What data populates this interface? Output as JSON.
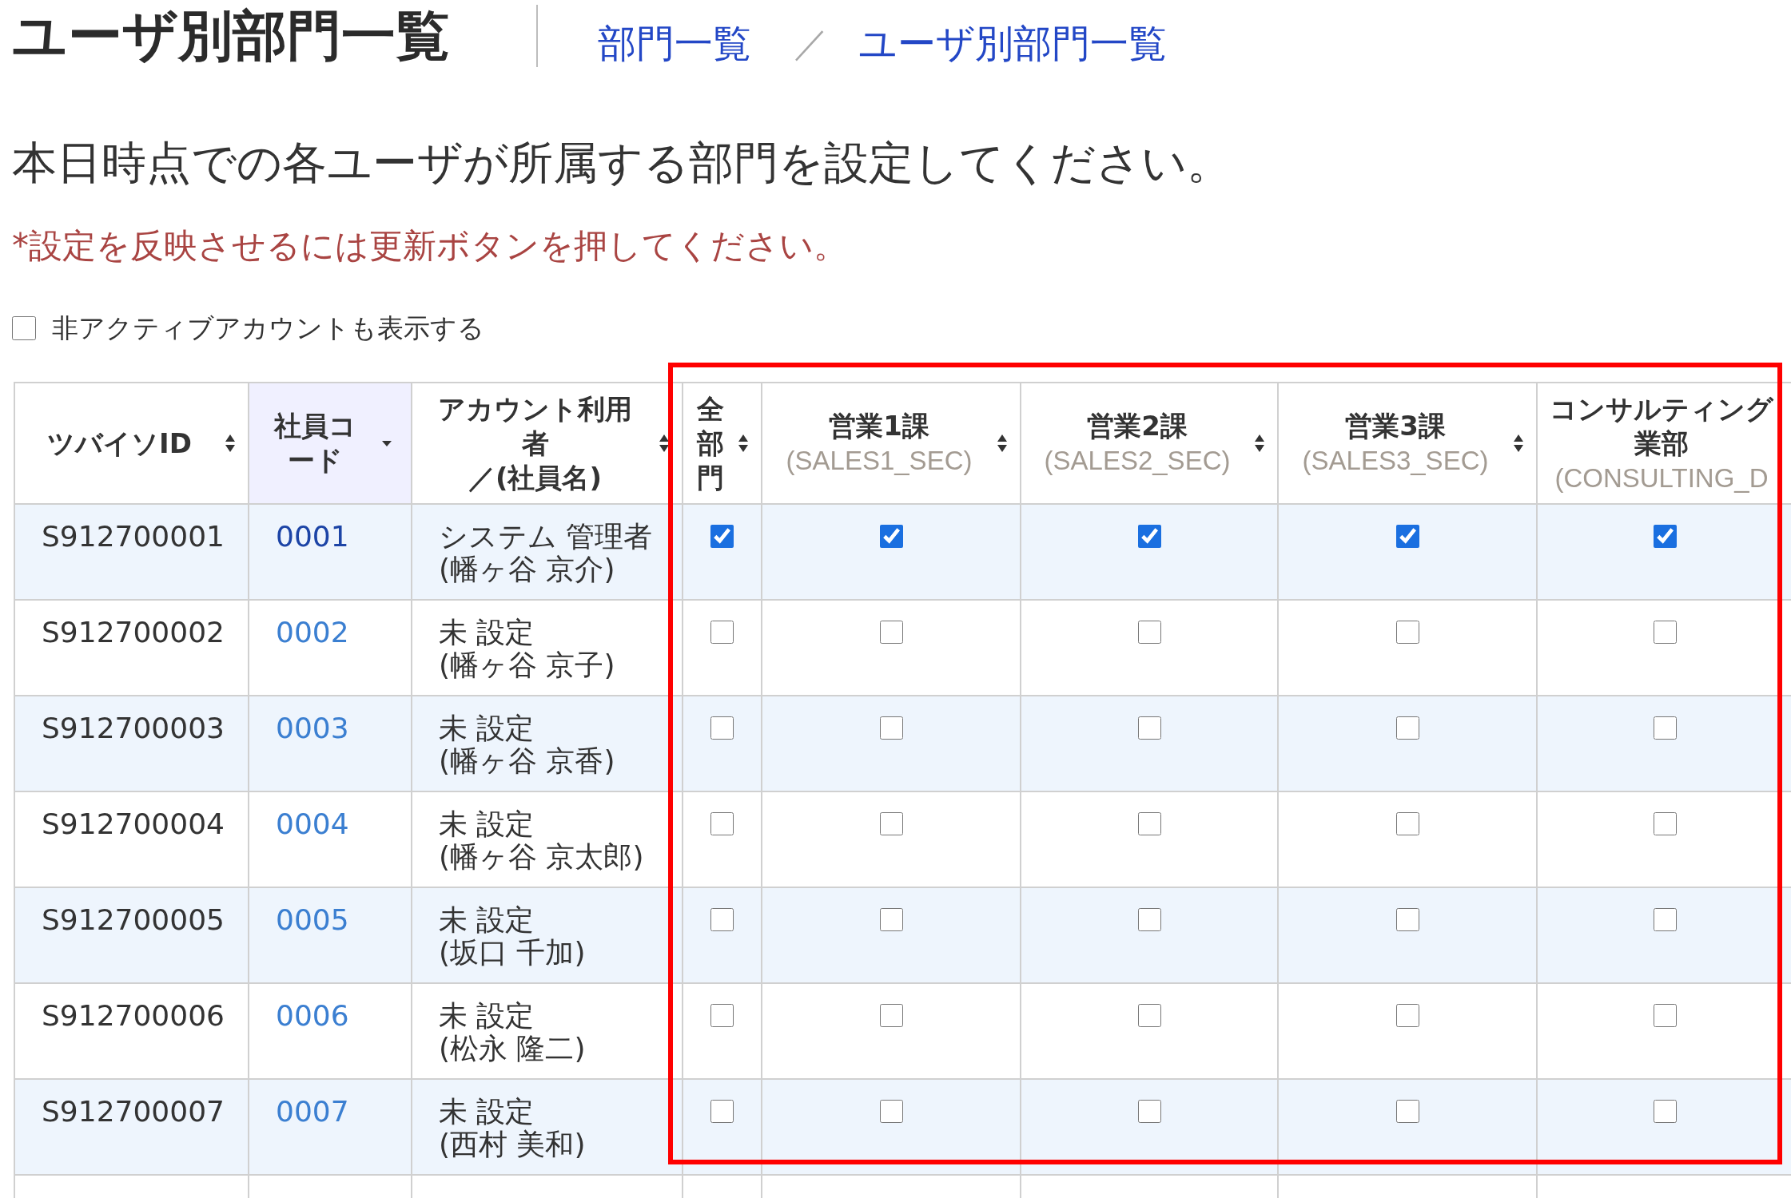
{
  "header": {
    "title": "ユーザ別部門一覧",
    "breadcrumb": [
      {
        "label": "部門一覧"
      },
      {
        "label": "ユーザ別部門一覧"
      }
    ],
    "breadcrumb_separator": "／"
  },
  "instruction": "本日時点での各ユーザが所属する部門を設定してください。",
  "note": "*設定を反映させるには更新ボタンを押してください。",
  "show_inactive": {
    "label": "非アクティブアカウントも表示する",
    "checked": false
  },
  "table": {
    "columns": [
      {
        "lines": [
          "ツバイソID"
        ],
        "sortable": true,
        "sorted": false
      },
      {
        "lines": [
          "社員コード"
        ],
        "sortable": true,
        "sorted": true
      },
      {
        "lines": [
          "アカウント利用者",
          "／(社員名)"
        ],
        "sortable": true,
        "sorted": false
      },
      {
        "lines": [
          "全部門"
        ],
        "sortable": true,
        "sorted": false
      },
      {
        "lines": [
          "営業1課"
        ],
        "code": "(SALES1_SEC)",
        "sortable": true,
        "sorted": false
      },
      {
        "lines": [
          "営業2課"
        ],
        "code": "(SALES2_SEC)",
        "sortable": true,
        "sorted": false
      },
      {
        "lines": [
          "営業3課"
        ],
        "code": "(SALES3_SEC)",
        "sortable": true,
        "sorted": false
      },
      {
        "lines": [
          "コンサルティング",
          "業部"
        ],
        "code": "(CONSULTING_D"
      }
    ],
    "rows": [
      {
        "user_id": "S912700001",
        "employee_code": "0001",
        "visited": true,
        "account_user": "システム 管理者",
        "employee_name": "(幡ヶ谷 京介)",
        "checks": [
          {
            "checked": true
          },
          {
            "checked": true
          },
          {
            "checked": true
          },
          {
            "checked": true
          },
          {
            "checked": true
          }
        ]
      },
      {
        "user_id": "S912700002",
        "employee_code": "0002",
        "visited": false,
        "account_user": "未 設定",
        "employee_name": "(幡ヶ谷 京子)",
        "checks": [
          {
            "checked": false
          },
          {
            "checked": false
          },
          {
            "checked": false
          },
          {
            "checked": false
          },
          {
            "checked": false
          }
        ]
      },
      {
        "user_id": "S912700003",
        "employee_code": "0003",
        "visited": false,
        "account_user": "未 設定",
        "employee_name": "(幡ヶ谷 京香)",
        "checks": [
          {
            "checked": false
          },
          {
            "checked": false
          },
          {
            "checked": false
          },
          {
            "checked": false
          },
          {
            "checked": false
          }
        ]
      },
      {
        "user_id": "S912700004",
        "employee_code": "0004",
        "visited": false,
        "account_user": "未 設定",
        "employee_name": "(幡ヶ谷 京太郎)",
        "checks": [
          {
            "checked": false
          },
          {
            "checked": false
          },
          {
            "checked": false
          },
          {
            "checked": false
          },
          {
            "checked": false
          }
        ]
      },
      {
        "user_id": "S912700005",
        "employee_code": "0005",
        "visited": false,
        "account_user": "未 設定",
        "employee_name": "(坂口 千加)",
        "checks": [
          {
            "checked": false
          },
          {
            "checked": false
          },
          {
            "checked": false
          },
          {
            "checked": false
          },
          {
            "checked": false
          }
        ]
      },
      {
        "user_id": "S912700006",
        "employee_code": "0006",
        "visited": false,
        "account_user": "未 設定",
        "employee_name": "(松永 隆二)",
        "checks": [
          {
            "checked": false
          },
          {
            "checked": false
          },
          {
            "checked": false
          },
          {
            "checked": false
          },
          {
            "checked": false
          }
        ]
      },
      {
        "user_id": "S912700007",
        "employee_code": "0007",
        "visited": false,
        "account_user": "未 設定",
        "employee_name": "(西村 美和)",
        "checks": [
          {
            "checked": false
          },
          {
            "checked": false
          },
          {
            "checked": false
          },
          {
            "checked": false
          },
          {
            "checked": false
          }
        ]
      }
    ]
  },
  "annotation": {
    "kind": "frame"
  }
}
